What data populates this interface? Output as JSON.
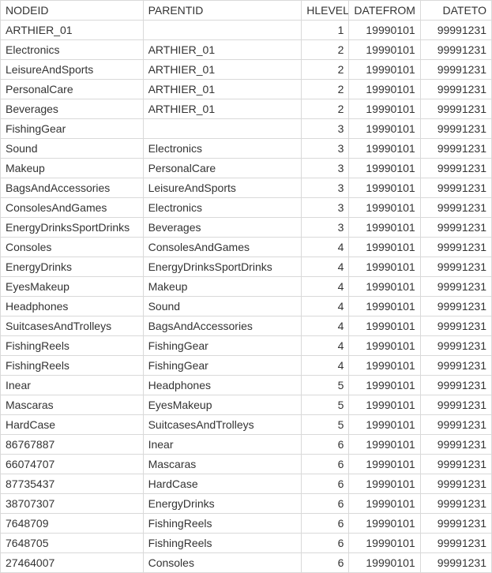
{
  "table": {
    "headers": {
      "nodeid": "NODEID",
      "parentid": "PARENTID",
      "hlevel": "HLEVEL",
      "datefrom": "DATEFROM",
      "dateto": "DATETO"
    },
    "rows": [
      {
        "nodeid": "ARTHIER_01",
        "parentid": "",
        "hlevel": "1",
        "datefrom": "19990101",
        "dateto": "99991231"
      },
      {
        "nodeid": "Electronics",
        "parentid": "ARTHIER_01",
        "hlevel": "2",
        "datefrom": "19990101",
        "dateto": "99991231"
      },
      {
        "nodeid": "LeisureAndSports",
        "parentid": "ARTHIER_01",
        "hlevel": "2",
        "datefrom": "19990101",
        "dateto": "99991231"
      },
      {
        "nodeid": "PersonalCare",
        "parentid": "ARTHIER_01",
        "hlevel": "2",
        "datefrom": "19990101",
        "dateto": "99991231"
      },
      {
        "nodeid": "Beverages",
        "parentid": "ARTHIER_01",
        "hlevel": "2",
        "datefrom": "19990101",
        "dateto": "99991231"
      },
      {
        "nodeid": "FishingGear",
        "parentid": "",
        "hlevel": "3",
        "datefrom": "19990101",
        "dateto": "99991231"
      },
      {
        "nodeid": "Sound",
        "parentid": "Electronics",
        "hlevel": "3",
        "datefrom": "19990101",
        "dateto": "99991231"
      },
      {
        "nodeid": "Makeup",
        "parentid": "PersonalCare",
        "hlevel": "3",
        "datefrom": "19990101",
        "dateto": "99991231"
      },
      {
        "nodeid": "BagsAndAccessories",
        "parentid": "LeisureAndSports",
        "hlevel": "3",
        "datefrom": "19990101",
        "dateto": "99991231"
      },
      {
        "nodeid": "ConsolesAndGames",
        "parentid": "Electronics",
        "hlevel": "3",
        "datefrom": "19990101",
        "dateto": "99991231"
      },
      {
        "nodeid": "EnergyDrinksSportDrinks",
        "parentid": "Beverages",
        "hlevel": "3",
        "datefrom": "19990101",
        "dateto": "99991231"
      },
      {
        "nodeid": "Consoles",
        "parentid": "ConsolesAndGames",
        "hlevel": "4",
        "datefrom": "19990101",
        "dateto": "99991231"
      },
      {
        "nodeid": "EnergyDrinks",
        "parentid": "EnergyDrinksSportDrinks",
        "hlevel": "4",
        "datefrom": "19990101",
        "dateto": "99991231"
      },
      {
        "nodeid": "EyesMakeup",
        "parentid": "Makeup",
        "hlevel": "4",
        "datefrom": "19990101",
        "dateto": "99991231"
      },
      {
        "nodeid": "Headphones",
        "parentid": "Sound",
        "hlevel": "4",
        "datefrom": "19990101",
        "dateto": "99991231"
      },
      {
        "nodeid": "SuitcasesAndTrolleys",
        "parentid": "BagsAndAccessories",
        "hlevel": "4",
        "datefrom": "19990101",
        "dateto": "99991231"
      },
      {
        "nodeid": "FishingReels",
        "parentid": "FishingGear",
        "hlevel": "4",
        "datefrom": "19990101",
        "dateto": "99991231"
      },
      {
        "nodeid": "FishingReels",
        "parentid": "FishingGear",
        "hlevel": "4",
        "datefrom": "19990101",
        "dateto": "99991231"
      },
      {
        "nodeid": "Inear",
        "parentid": "Headphones",
        "hlevel": "5",
        "datefrom": "19990101",
        "dateto": "99991231"
      },
      {
        "nodeid": "Mascaras",
        "parentid": "EyesMakeup",
        "hlevel": "5",
        "datefrom": "19990101",
        "dateto": "99991231"
      },
      {
        "nodeid": "HardCase",
        "parentid": "SuitcasesAndTrolleys",
        "hlevel": "5",
        "datefrom": "19990101",
        "dateto": "99991231"
      },
      {
        "nodeid": "86767887",
        "parentid": "Inear",
        "hlevel": "6",
        "datefrom": "19990101",
        "dateto": "99991231"
      },
      {
        "nodeid": "66074707",
        "parentid": "Mascaras",
        "hlevel": "6",
        "datefrom": "19990101",
        "dateto": "99991231"
      },
      {
        "nodeid": "87735437",
        "parentid": "HardCase",
        "hlevel": "6",
        "datefrom": "19990101",
        "dateto": "99991231"
      },
      {
        "nodeid": "38707307",
        "parentid": "EnergyDrinks",
        "hlevel": "6",
        "datefrom": "19990101",
        "dateto": "99991231"
      },
      {
        "nodeid": "7648709",
        "parentid": "FishingReels",
        "hlevel": "6",
        "datefrom": "19990101",
        "dateto": "99991231"
      },
      {
        "nodeid": "7648705",
        "parentid": "FishingReels",
        "hlevel": "6",
        "datefrom": "19990101",
        "dateto": "99991231"
      },
      {
        "nodeid": "27464007",
        "parentid": "Consoles",
        "hlevel": "6",
        "datefrom": "19990101",
        "dateto": "99991231"
      }
    ]
  }
}
